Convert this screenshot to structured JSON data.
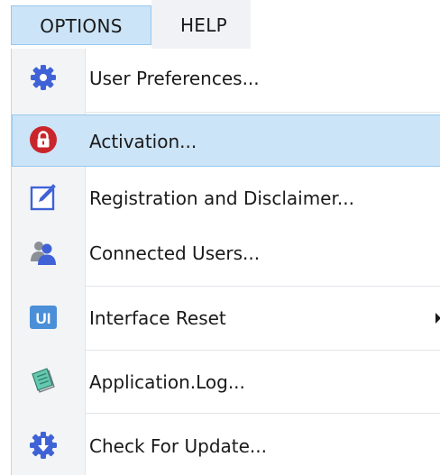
{
  "menubar": {
    "items": [
      {
        "label": "OPTIONS"
      },
      {
        "label": "HELP"
      }
    ]
  },
  "dropdown": {
    "items": [
      {
        "label": "User Preferences...",
        "icon": "gear-icon"
      },
      {
        "label": "Activation...",
        "icon": "lock-icon"
      },
      {
        "label": "Registration and Disclaimer...",
        "icon": "edit-icon"
      },
      {
        "label": "Connected Users...",
        "icon": "users-icon"
      },
      {
        "label": "Interface Reset",
        "icon": "ui-icon",
        "icon_text": "UI"
      },
      {
        "label": "Application.Log...",
        "icon": "log-book-icon"
      },
      {
        "label": "Check For Update...",
        "icon": "update-icon"
      }
    ]
  },
  "colors": {
    "highlight": "#cce4f7",
    "highlight_border": "#99c9ef",
    "icon_blue": "#3f63d6",
    "icon_red": "#c9262b",
    "icon_light_blue": "#4a8fd8"
  }
}
